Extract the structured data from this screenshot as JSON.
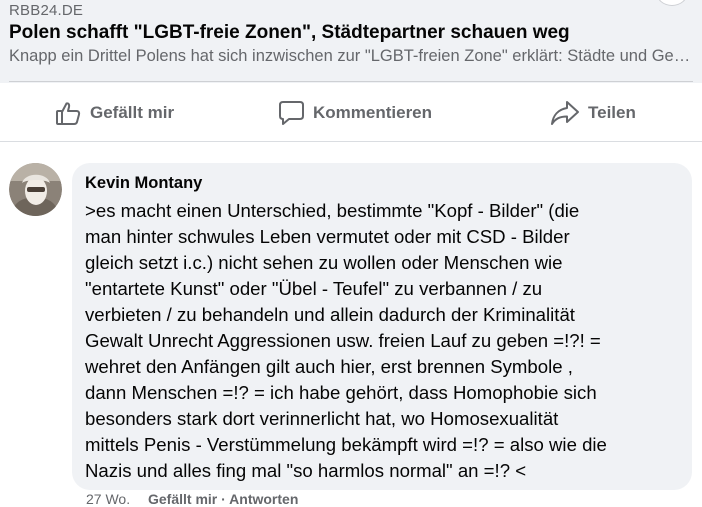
{
  "preview": {
    "source": "RBB24.DE",
    "title": "Polen schafft \"LGBT-freie Zonen\", Städtepartner schauen weg",
    "description": "Knapp ein Drittel Polens hat sich inzwischen zur \"LGBT-freien Zone\" erklärt: Städte und Gemeinden..."
  },
  "actions": {
    "like": "Gefällt mir",
    "comment": "Kommentieren",
    "share": "Teilen"
  },
  "comment": {
    "author": "Kevin Montany",
    "text": ">es macht einen Unterschied, bestimmte \"Kopf - Bilder\" (die\nman hinter schwules Leben vermutet oder mit  CSD - Bilder\ngleich setzt i.c.) nicht sehen zu wollen oder Menschen  wie\n\"entartete Kunst\" oder \"Übel - Teufel\" zu verbannen / zu\nverbieten / zu behandeln und allein dadurch der Kriminalität\nGewalt Unrecht Aggressionen usw. freien Lauf zu geben =!?! =\nwehret den Anfängen gilt auch hier, erst brennen Symbole ,\ndann Menschen =!? = ich habe gehört, dass Homophobie sich\nbesonders stark  dort verinnerlicht hat, wo Homosexualität\nmittels Penis - Verstümmelung bekämpft wird =!? = also wie die\nNazis und alles fing mal \"so harmlos normal\" an =!? <",
    "time": "27 Wo.",
    "like_reply": "Gefällt mir · Antworten"
  },
  "colors": {
    "preview_bg": "#f0f2f5",
    "bubble_bg": "#f0f2f5",
    "secondary_text": "#65676b",
    "primary_text": "#050505"
  },
  "icons": {
    "like": "thumbs-up-icon",
    "comment": "speech-bubble-icon",
    "share": "share-arrow-icon"
  }
}
